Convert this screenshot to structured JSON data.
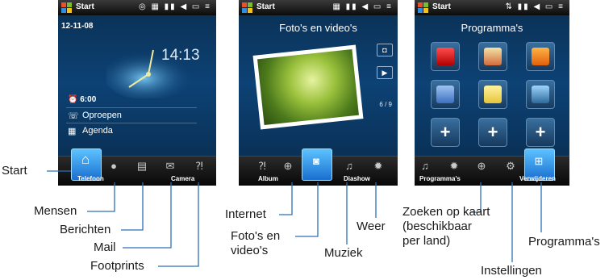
{
  "screens": [
    {
      "status_title": "Start",
      "date": "12-11-08",
      "clock_time": "14:13",
      "alarm": "6:00",
      "items": [
        "Oproepen",
        "Agenda"
      ],
      "bar_labels": {
        "left": "Telefoon",
        "right": "Camera"
      }
    },
    {
      "status_title": "Start",
      "title": "Foto's en video's",
      "counter": "6 / 9",
      "bar_labels": {
        "left": "Album",
        "right": "Diashow"
      }
    },
    {
      "status_title": "Start",
      "title": "Programma's",
      "bar_labels": {
        "left": "Programma's",
        "right": "Verwijderen"
      }
    }
  ],
  "callouts": {
    "start": "Start",
    "mensen": "Mensen",
    "berichten": "Berichten",
    "mail": "Mail",
    "footprints": "Footprints",
    "internet": "Internet",
    "fotos_line1": "Foto's en",
    "fotos_line2": "video's",
    "muziek": "Muziek",
    "weer": "Weer",
    "zoeken_line1": "Zoeken op kaart",
    "zoeken_line2": "(beschikbaar",
    "zoeken_line3": "per land)",
    "instellingen": "Instellingen",
    "programmas": "Programma's"
  },
  "colors": {
    "screen_bg": "#0d4275",
    "selected_tab": "#2a8be6",
    "callout_line": "#2d6fb8"
  }
}
